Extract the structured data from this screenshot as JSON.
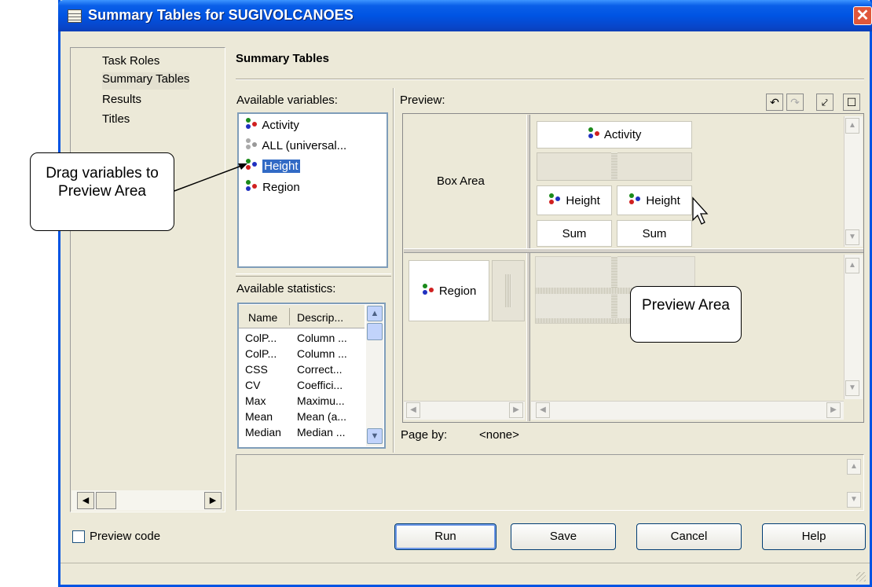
{
  "window": {
    "title": "Summary Tables for SUGIVOLCANOES",
    "close_glyph": "✕"
  },
  "nav": {
    "items": [
      {
        "label": "Task Roles",
        "selected": false
      },
      {
        "label": "Summary Tables",
        "selected": true
      },
      {
        "label": "Results",
        "selected": false
      },
      {
        "label": "Titles",
        "selected": false
      }
    ]
  },
  "section_title": "Summary Tables",
  "variables": {
    "label": "Available variables:",
    "items": [
      {
        "label": "Activity",
        "icon": "classification-variable-icon"
      },
      {
        "label": "ALL (universal...",
        "icon": "universal-class-icon"
      },
      {
        "label": "Height",
        "icon": "analysis-variable-icon",
        "selected": true
      },
      {
        "label": "Region",
        "icon": "classification-variable-icon"
      }
    ]
  },
  "statistics": {
    "label": "Available statistics:",
    "columns": [
      "Name",
      "Descrip..."
    ],
    "rows": [
      [
        "ColP...",
        "Column ..."
      ],
      [
        "ColP...",
        "Column ..."
      ],
      [
        "CSS",
        "Correct..."
      ],
      [
        "CV",
        "Coeffici..."
      ],
      [
        "Max",
        "Maximu..."
      ],
      [
        "Mean",
        "Mean (a..."
      ],
      [
        "Median",
        "Median ..."
      ]
    ]
  },
  "preview": {
    "label": "Preview:",
    "box_area": "Box Area",
    "column_header": "Activity",
    "column_vars": [
      "Height",
      "Height"
    ],
    "column_stats": [
      "Sum",
      "Sum"
    ],
    "row_header": "Region",
    "page_by_label": "Page by:",
    "page_by_value": "<none>"
  },
  "toolbar": {
    "undo": "↶",
    "redo": "↷",
    "pivot": "⤦",
    "maximize": "☐"
  },
  "preview_code": {
    "label": "Preview code",
    "checked": false
  },
  "buttons": {
    "run": "Run",
    "save": "Save",
    "cancel": "Cancel",
    "help": "Help"
  },
  "callouts": {
    "drag": "Drag variables to Preview Area",
    "preview": "Preview Area"
  },
  "colors": {
    "titlebar": "#0054e3",
    "selection": "#316ac5",
    "dialog_bg": "#ece9d8"
  }
}
